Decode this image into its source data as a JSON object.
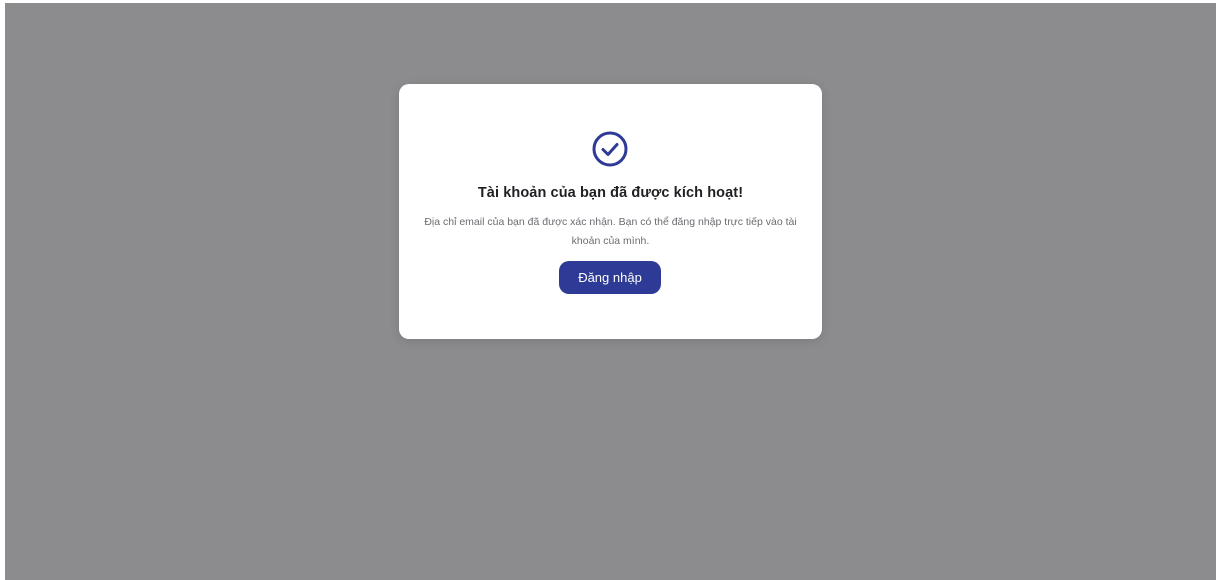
{
  "overlay": {
    "color": "#8c8c8e"
  },
  "modal": {
    "icon": "check-circle-icon",
    "icon_color": "#2d3a96",
    "title": "Tài khoản của bạn đã được kích hoạt!",
    "message": "Địa chỉ email của bạn đã được xác nhận. Bạn có thể đăng nhập trực tiếp vào tài khoản của mình.",
    "login_button_label": "Đăng nhập",
    "button_color": "#2d3a96"
  }
}
